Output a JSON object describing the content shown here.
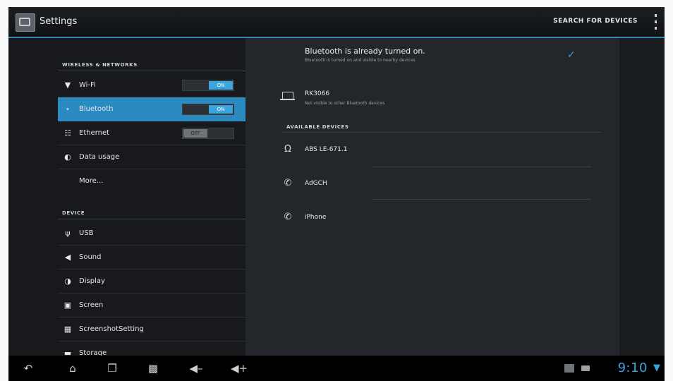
{
  "actionbar": {
    "title": "Settings",
    "search_label": "SEARCH FOR DEVICES",
    "menu_icon": "overflow-menu-icon"
  },
  "left": {
    "section1": "WIRELESS & NETWORKS",
    "section2": "DEVICE",
    "items": [
      {
        "label": "Wi-Fi",
        "icon": "wifi-icon",
        "toggle": "ON"
      },
      {
        "label": "Bluetooth",
        "icon": "bluetooth-icon",
        "toggle": "ON"
      },
      {
        "label": "Ethernet",
        "icon": "ethernet-icon",
        "toggle": "OFF"
      },
      {
        "label": "Data usage",
        "icon": "data-usage-icon"
      },
      {
        "label": "More..."
      },
      {
        "label": "USB",
        "icon": "usb-icon"
      },
      {
        "label": "Sound",
        "icon": "sound-icon"
      },
      {
        "label": "Display",
        "icon": "display-icon"
      },
      {
        "label": "Screen",
        "icon": "screen-icon"
      },
      {
        "label": "ScreenshotSetting",
        "icon": "screenshot-icon"
      },
      {
        "label": "Storage",
        "icon": "storage-icon"
      }
    ]
  },
  "right": {
    "status": "Bluetooth is already turned on.",
    "status_sub": "Bluetooth is turned on and visible to nearby devices",
    "self_device": {
      "name": "RK3066",
      "sub": "Not visible to other Bluetooth devices"
    },
    "available_header": "AVAILABLE DEVICES",
    "devices": [
      {
        "name": "ABS LE-671.1",
        "icon": "headphones-icon"
      },
      {
        "name": "AdGCH",
        "icon": "phone-icon"
      },
      {
        "name": "iPhone",
        "icon": "phone-icon"
      }
    ]
  },
  "navbar": {
    "clock": "9:10",
    "buttons": [
      "back-icon",
      "home-icon",
      "recent-apps-icon",
      "screenshot-icon",
      "volume-down-icon",
      "volume-up-icon"
    ]
  }
}
